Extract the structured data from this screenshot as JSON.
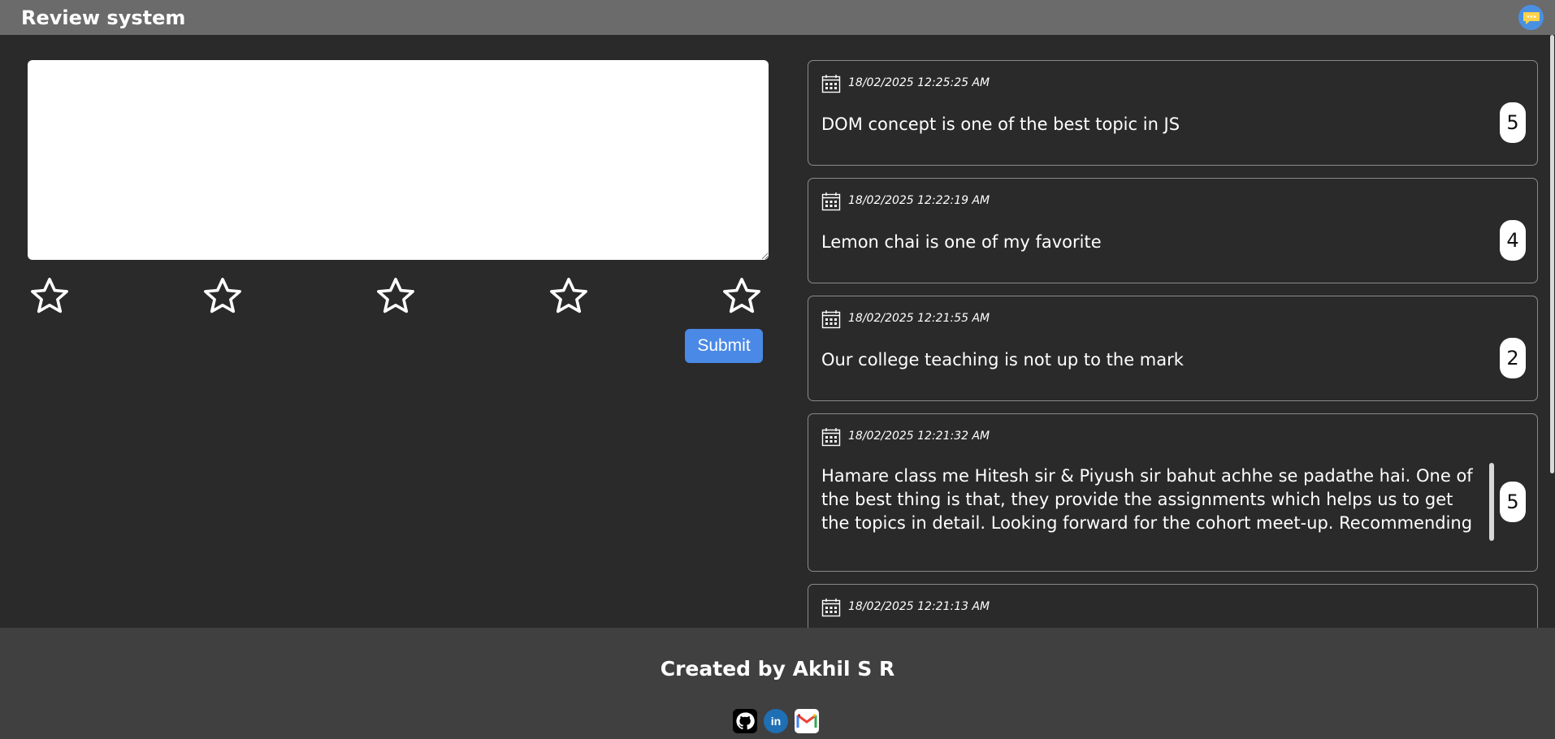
{
  "header": {
    "title": "Review system",
    "chat_icon": "chat-bubble-icon"
  },
  "form": {
    "textarea_value": "",
    "textarea_placeholder": "",
    "star_count": 5,
    "selected_rating": 0,
    "submit_label": "Submit"
  },
  "reviews": [
    {
      "date": "18/02/2025 12:25:25 AM",
      "text": "DOM concept is one of the best topic in JS",
      "rating": "5"
    },
    {
      "date": "18/02/2025 12:22:19 AM",
      "text": "Lemon chai is one of my favorite",
      "rating": "4"
    },
    {
      "date": "18/02/2025 12:21:55 AM",
      "text": "Our college teaching is not up to the mark",
      "rating": "2"
    },
    {
      "date": "18/02/2025 12:21:32 AM",
      "text": "Hamare class me Hitesh sir & Piyush sir bahut achhe se padathe hai. One of the best thing is that, they provide the assignments which helps us to get the topics in detail. Looking forward for the cohort meet-up. Recommending each and everyone to join",
      "rating": "5"
    },
    {
      "date": "18/02/2025 12:21:13 AM",
      "text": "",
      "rating": ""
    }
  ],
  "footer": {
    "credit": "Created by Akhil S R",
    "social": [
      "github-icon",
      "linkedin-icon",
      "gmail-icon"
    ],
    "linkedin_glyph": "in"
  },
  "colors": {
    "background": "#2a2a2a",
    "header": "#6b6b6b",
    "footer": "#404040",
    "accent": "#4a89e6"
  }
}
